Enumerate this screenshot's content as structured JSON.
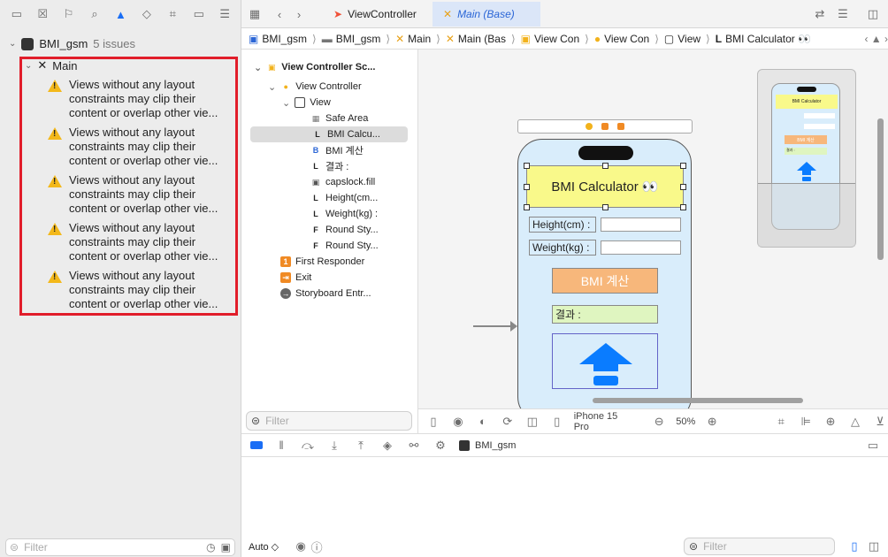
{
  "navigator": {
    "toolbar_icons": [
      "folder-icon",
      "x-square-icon",
      "bookmark-icon",
      "search-icon",
      "warning-icon",
      "diamond-icon",
      "tag-icon",
      "label-icon",
      "list-icon"
    ],
    "project": {
      "name": "BMI_gsm",
      "issue_count": "5 issues"
    },
    "group": {
      "name": "Main"
    },
    "issues": [
      {
        "text": "Views without any layout constraints may clip their content or overlap other vie..."
      },
      {
        "text": "Views without any layout constraints may clip their content or overlap other vie..."
      },
      {
        "text": "Views without any layout constraints may clip their content or overlap other vie..."
      },
      {
        "text": "Views without any layout constraints may clip their content or overlap other vie..."
      },
      {
        "text": "Views without any layout constraints may clip their content or overlap other vie..."
      }
    ],
    "filter_placeholder": "Filter"
  },
  "editor": {
    "tabs": [
      {
        "label": "ViewController"
      },
      {
        "label": "Main (Base)"
      }
    ],
    "jumpbar": [
      "BMI_gsm",
      "BMI_gsm",
      "Main",
      "Main (Bas",
      "View Con",
      "View Con",
      "View",
      "BMI Calculator 👀"
    ]
  },
  "outline": {
    "rows": [
      {
        "label": "View Controller Sc...",
        "glyph": "▣",
        "color": "#f2b21c"
      },
      {
        "label": "View Controller",
        "glyph": "●",
        "color": "#f2b21c"
      },
      {
        "label": "View",
        "glyph": "▢",
        "color": "#444"
      },
      {
        "label": "Safe Area",
        "glyph": "▦",
        "color": "#777"
      },
      {
        "label": "BMI Calcu...",
        "glyph": "L",
        "color": "#222"
      },
      {
        "label": "BMI 계산",
        "glyph": "B",
        "color": "#2b66d6"
      },
      {
        "label": "결과 :",
        "glyph": "L",
        "color": "#222"
      },
      {
        "label": "capslock.fill",
        "glyph": "▣",
        "color": "#555"
      },
      {
        "label": "Height(cm...",
        "glyph": "L",
        "color": "#222"
      },
      {
        "label": "Weight(kg) :",
        "glyph": "L",
        "color": "#222"
      },
      {
        "label": "Round Sty...",
        "glyph": "F",
        "color": "#222"
      },
      {
        "label": "Round Sty...",
        "glyph": "F",
        "color": "#222"
      },
      {
        "label": "First Responder",
        "glyph": "1",
        "color": "#f08a24"
      },
      {
        "label": "Exit",
        "glyph": "⇥",
        "color": "#f08a24"
      },
      {
        "label": "Storyboard Entr...",
        "glyph": "→",
        "color": "#666"
      }
    ],
    "filter_placeholder": "Filter"
  },
  "canvas": {
    "title": "BMI Calculator 👀",
    "height_label": "Height(cm) :",
    "weight_label": "Weight(kg) :",
    "button_label": "BMI 계산",
    "result_label": "결과 :",
    "minimap_title": "BMI Calculator",
    "minimap_button": "BMI 계산",
    "minimap_result": "결과 :"
  },
  "canvas_bar": {
    "device": "iPhone 15 Pro",
    "zoom": "50%"
  },
  "debug_bar": {
    "target": "BMI_gsm"
  },
  "bottom": {
    "auto": "Auto ◇",
    "filter_placeholder": "Filter"
  },
  "colors": {
    "accent": "#1a6ef5",
    "warning": "#f3b81a",
    "highlight": "#e11d2a"
  }
}
